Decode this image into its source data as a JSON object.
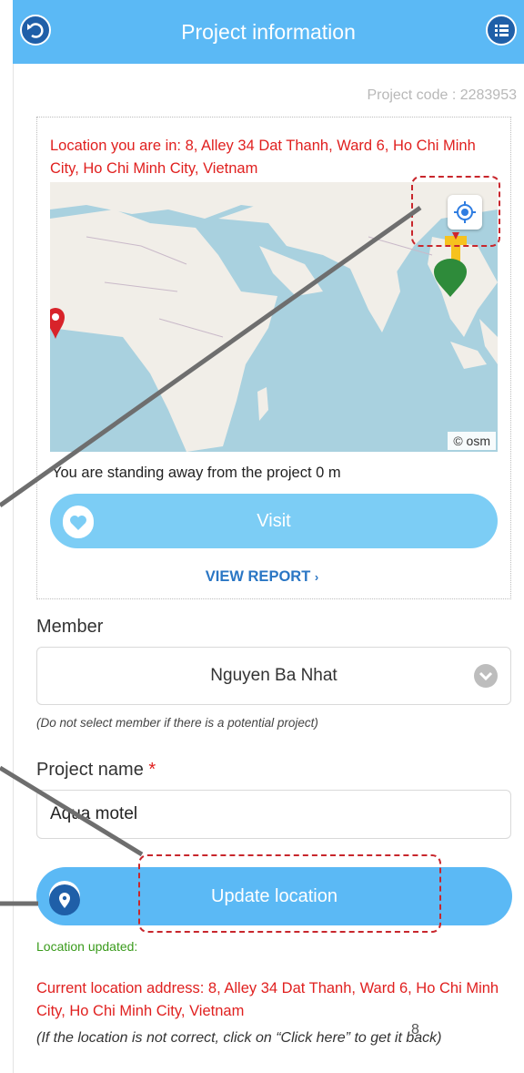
{
  "header": {
    "title": "Project information",
    "back_icon": "back-icon",
    "menu_icon": "list-icon"
  },
  "project_code": "Project code : 2283953",
  "location": {
    "you_are_in": "Location you are in: 8, Alley 34 Dat Thanh, Ward 6, Ho Chi Minh City, Ho Chi Minh City, Vietnam",
    "map_attribution": "© osm",
    "distance_text": "You are standing away from the project 0 m"
  },
  "visit_button": "Visit",
  "view_report": "VIEW REPORT",
  "view_report_arrow": "›",
  "member": {
    "label": "Member",
    "selected": "Nguyen Ba Nhat",
    "hint": "(Do not select member if there is a potential project)"
  },
  "project_name": {
    "label": "Project name",
    "required": "*",
    "value": "Aqua motel"
  },
  "update_location_button": "Update location",
  "status": {
    "updated": "Location updated:",
    "current_address": "Current location address: 8, Alley 34 Dat Thanh, Ward 6, Ho Chi Minh City, Ho Chi Minh City, Vietnam",
    "note": "(If the location is not correct, click on “Click here” to get it back)",
    "step_number": "8"
  },
  "colors": {
    "header": "#5bb9f5",
    "button": "#7ccdf5",
    "error_red": "#e0201f",
    "success_green": "#3a9b1c"
  }
}
